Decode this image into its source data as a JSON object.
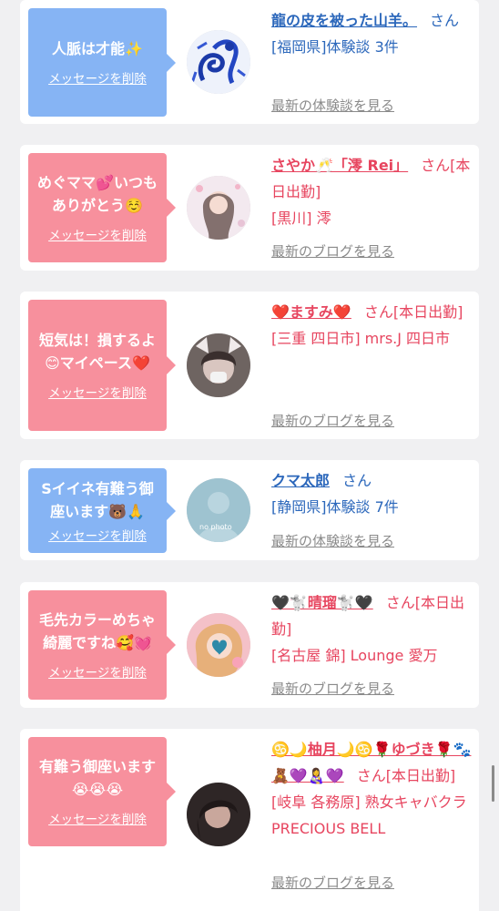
{
  "cards": [
    {
      "message": "人脈は才能✨",
      "delete_label": "メッセージを削除",
      "name": "龍の皮を被った山羊。",
      "honorific": "さん",
      "detail": "[福岡県]体験談 3件",
      "latest_link": "最新の体験談を見る",
      "theme": "blue"
    },
    {
      "message": "めぐママ💕いつもありがとう☺️",
      "delete_label": "メッセージを削除",
      "name": "さやか🥂「澪 Rei」",
      "honorific": "さん[本日出勤]",
      "detail": "[黒川] 澪",
      "latest_link": "最新のブログを見る",
      "theme": "pink"
    },
    {
      "message": "短気は！損するよ😊マイペース❤️",
      "delete_label": "メッセージを削除",
      "name": "❤️ますみ❤️",
      "honorific": "さん[本日出勤]",
      "detail": "[三重 四日市] mrs.J 四日市",
      "latest_link": "最新のブログを見る",
      "theme": "pink"
    },
    {
      "message": "Sイイネ有難う御座います🐻🙏",
      "delete_label": "メッセージを削除",
      "name": "クマ太郎",
      "honorific": "さん",
      "detail": "[静岡県]体験談 7件",
      "latest_link": "最新の体験談を見る",
      "theme": "blue",
      "avatar_text": "no photo"
    },
    {
      "message": "毛先カラーめちゃ綺麗ですね🥰💓",
      "delete_label": "メッセージを削除",
      "name": "🖤🐩晴瑠🐩🖤",
      "honorific": "さん[本日出勤]",
      "detail": "[名古屋 錦] Lounge 愛万",
      "latest_link": "最新のブログを見る",
      "theme": "pink"
    },
    {
      "message": "有難う御座います😭😭😭",
      "delete_label": "メッセージを削除",
      "name": "♋️🌙柚月🌙♋️🌹ゆづき🌹🐾🧸💜👩‍🍼💜",
      "honorific": "さん[本日出勤]",
      "detail": "[岐阜 各務原] 熟女キャバクラ PRECIOUS BELL",
      "latest_link": "最新のブログを見る",
      "theme": "pink"
    }
  ]
}
